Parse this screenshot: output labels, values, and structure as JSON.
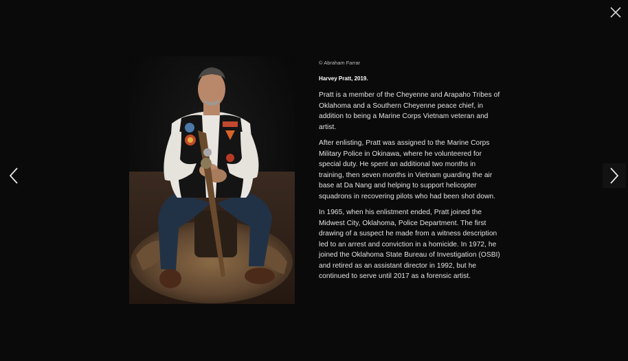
{
  "lightbox": {
    "close_icon": "close-icon",
    "prev_icon": "chevron-left-icon",
    "next_icon": "chevron-right-icon"
  },
  "photo": {
    "alt": "Portrait of Harvey Pratt seated on an animal hide holding a carved staff"
  },
  "caption": {
    "credit": "© Abraham Farrar",
    "title": "Harvey Pratt, 2019.",
    "paragraphs": [
      "Pratt is a member of the Cheyenne and Arapaho Tribes of Oklahoma and a Southern Cheyenne peace chief, in addition to being a Marine Corps Vietnam veteran and artist.",
      "After enlisting, Pratt was assigned to the Marine Corps Military Police in Okinawa, where he volunteered for special duty. He spent an additional two months in training, then seven months in Vietnam guarding the air base at Da Nang and helping to support helicopter squadrons in recovering pilots who had been shot down.",
      "In 1965, when his enlistment ended, Pratt joined the Midwest City, Oklahoma, Police Department. The first drawing of a suspect he made from a witness description led to an arrest and conviction in a homicide. In 1972, he joined the Oklahoma State Bureau of Investigation (OSBI) and retired as an assistant director in 1992, but he continued to serve until 2017 as a forensic artist."
    ]
  }
}
